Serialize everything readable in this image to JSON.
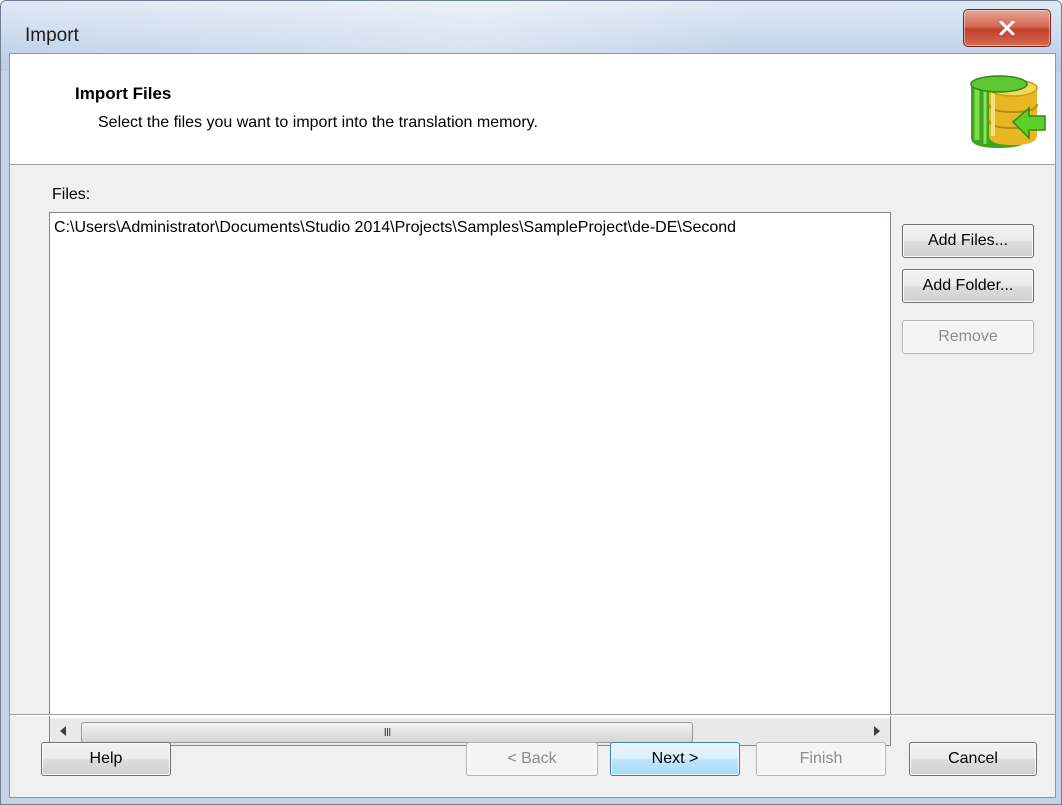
{
  "window": {
    "title": "Import"
  },
  "header": {
    "title": "Import Files",
    "subtitle": "Select the files you want to import into the translation memory."
  },
  "files": {
    "label": "Files:",
    "items": [
      "C:\\Users\\Administrator\\Documents\\Studio 2014\\Projects\\Samples\\SampleProject\\de-DE\\Second"
    ],
    "scroll_grip": "III"
  },
  "side_buttons": {
    "add_files": "Add Files...",
    "add_folder": "Add Folder...",
    "remove": "Remove"
  },
  "footer": {
    "help": "Help",
    "back": "< Back",
    "next": "Next >",
    "finish": "Finish",
    "cancel": "Cancel"
  },
  "icons": {
    "close": "close-icon",
    "database_import": "database-import-icon",
    "scroll_left": "arrow-left-icon",
    "scroll_right": "arrow-right-icon"
  },
  "colors": {
    "close_button": "#c94a35",
    "db_green": "#4fbf2a",
    "db_yellow": "#f2c62c",
    "default_button_border": "#3c7fb1"
  },
  "state": {
    "remove_enabled": false,
    "back_enabled": false,
    "finish_enabled": false,
    "default_button": "next"
  }
}
